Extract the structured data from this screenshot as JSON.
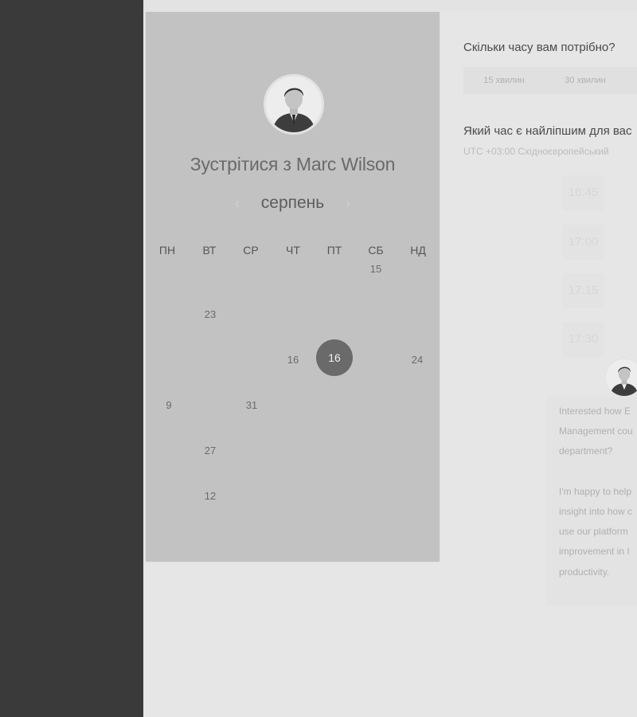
{
  "calendar": {
    "title": "Зустрітися з Marc Wilson",
    "month": "серпень",
    "prev_icon": "‹",
    "next_icon": "›",
    "weekdays": [
      "ПН",
      "ВТ",
      "СР",
      "ЧТ",
      "ПТ",
      "СБ",
      "НД"
    ],
    "days": {
      "r1_sat": "15",
      "r2_tue": "23",
      "r3_thu": "16",
      "r3_fri_selected": "16",
      "r3_sun": "24",
      "r4_mon": "9",
      "r4_wed": "31",
      "r5_tue": "27",
      "r6_tue": "12"
    }
  },
  "duration": {
    "question": "Скільки часу вам потрібно?",
    "options": [
      "15 хвилин",
      "30 хвилин"
    ]
  },
  "time": {
    "question": "Який час є найліпшим для вас",
    "timezone": "UTC +03:00 Східноєвропейський",
    "slots": [
      "16:45",
      "17:00",
      "17:15",
      "17:30"
    ]
  },
  "message": {
    "lines": [
      "Interested how E",
      "Management cou",
      "department?",
      "I'm happy to help",
      "insight into how c",
      "use our platform",
      "improvement in I",
      "productivity."
    ]
  }
}
